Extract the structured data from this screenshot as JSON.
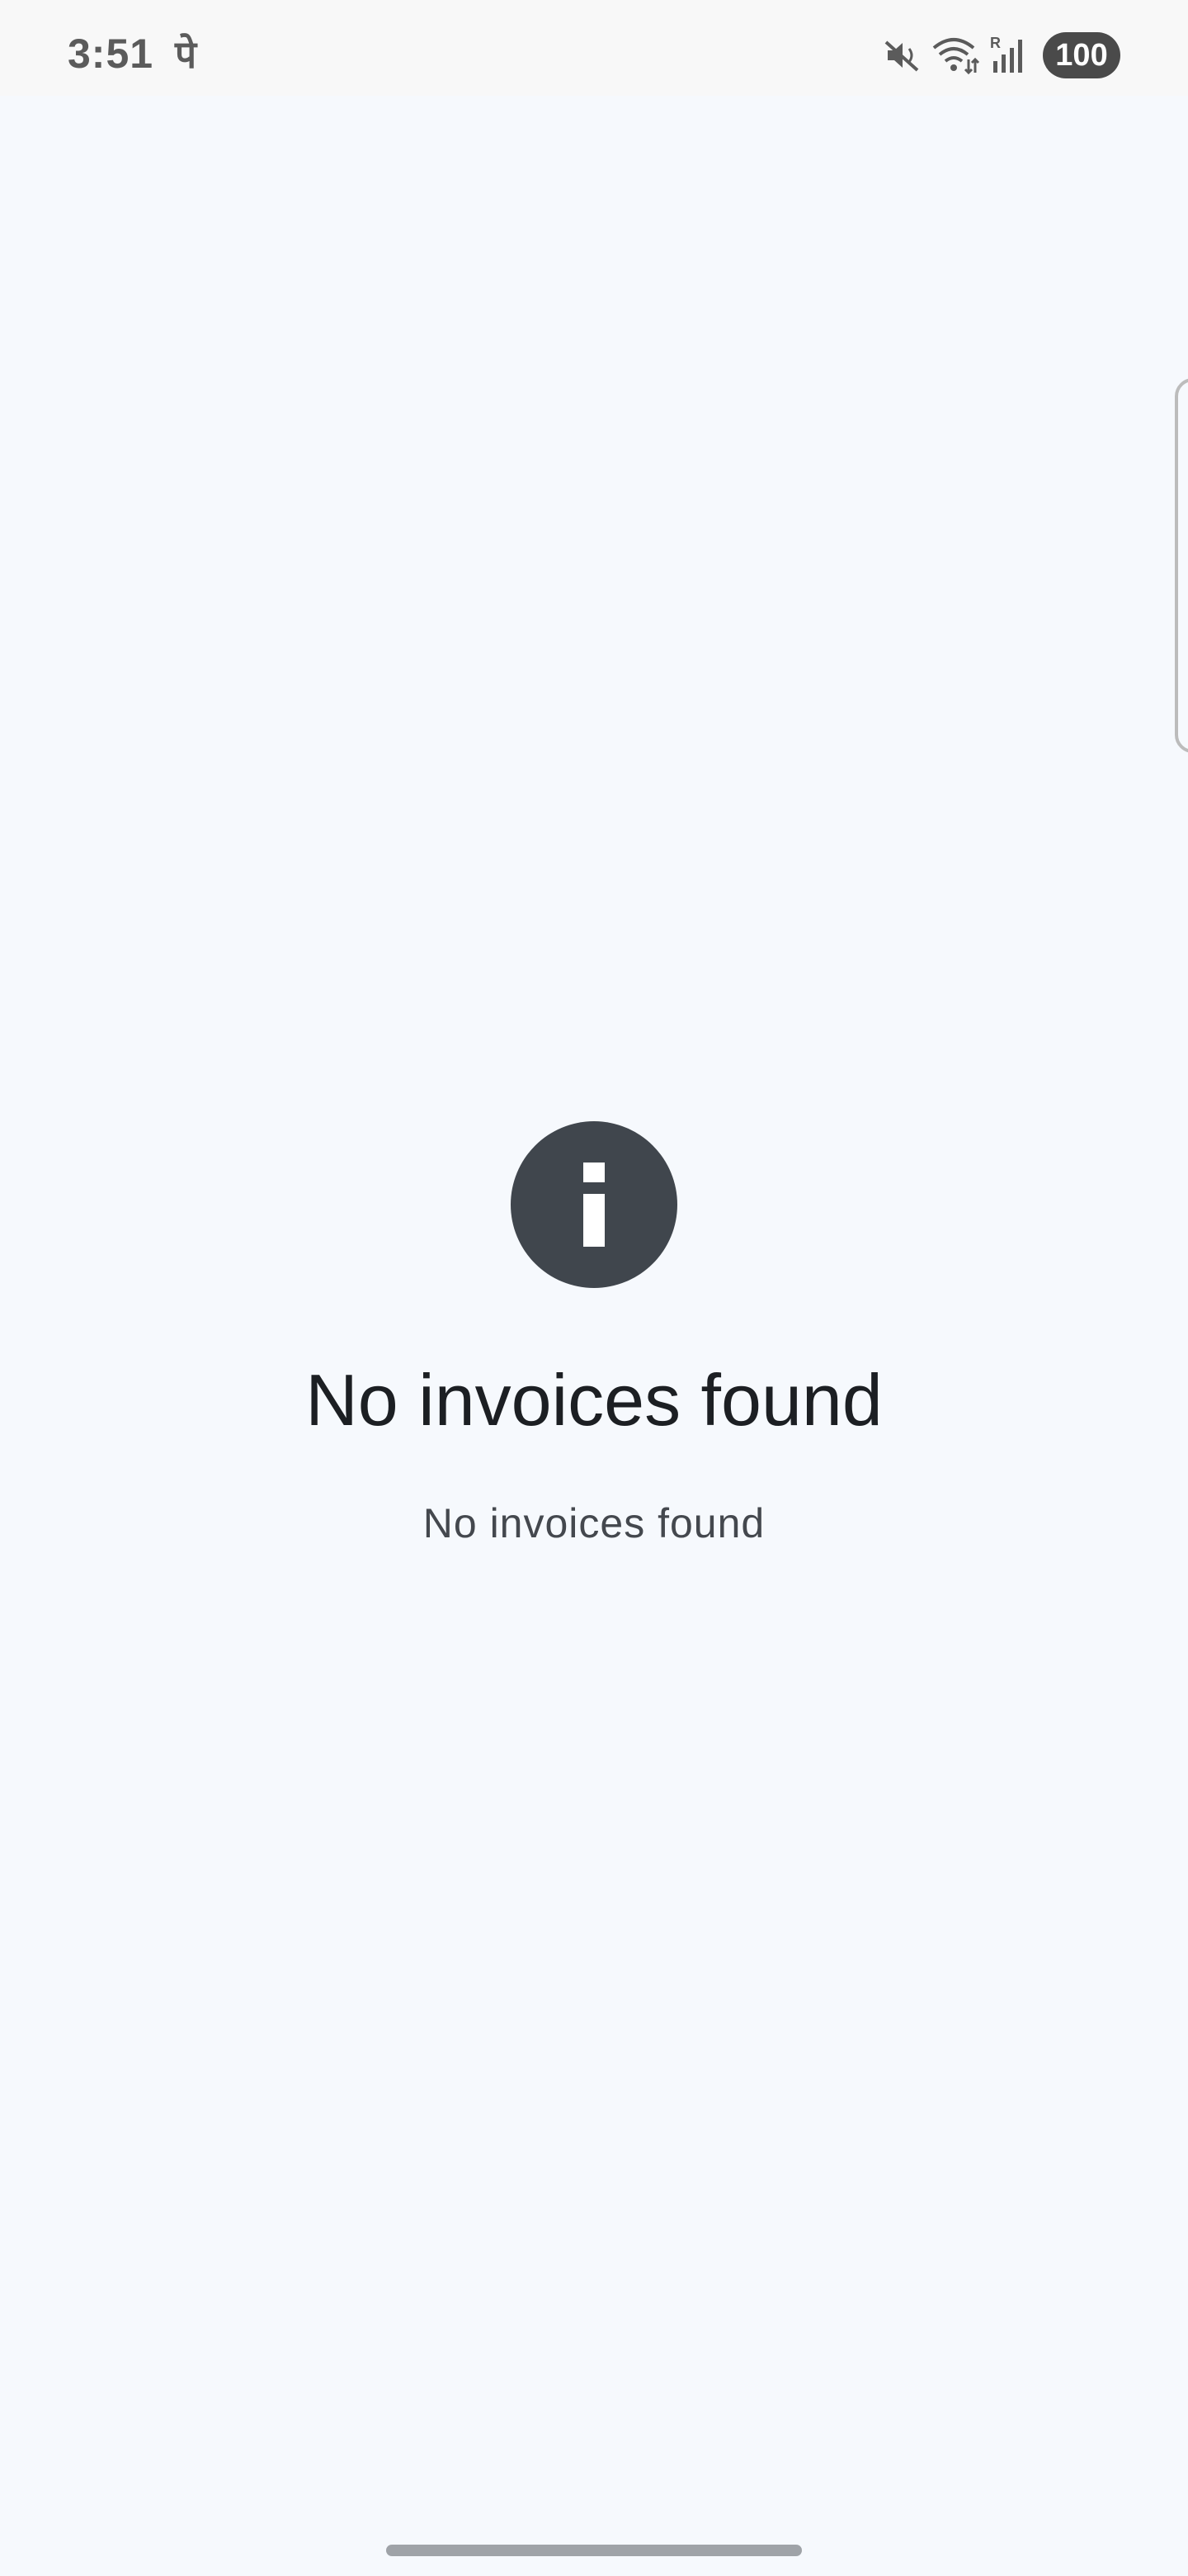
{
  "status_bar": {
    "time": "3:51",
    "notification_glyph": "पे",
    "icons": [
      "mute-icon",
      "wifi-icon",
      "signal-icon"
    ],
    "battery_level": "100"
  },
  "empty_state": {
    "icon": "info-icon",
    "title": "No invoices found",
    "subtitle": "No invoices found"
  },
  "colors": {
    "background": "#f6f9fd",
    "icon_fill": "#40464d",
    "title_text": "#1c1f23",
    "subtitle_text": "#44484e",
    "status_text": "#5b5b5b"
  }
}
